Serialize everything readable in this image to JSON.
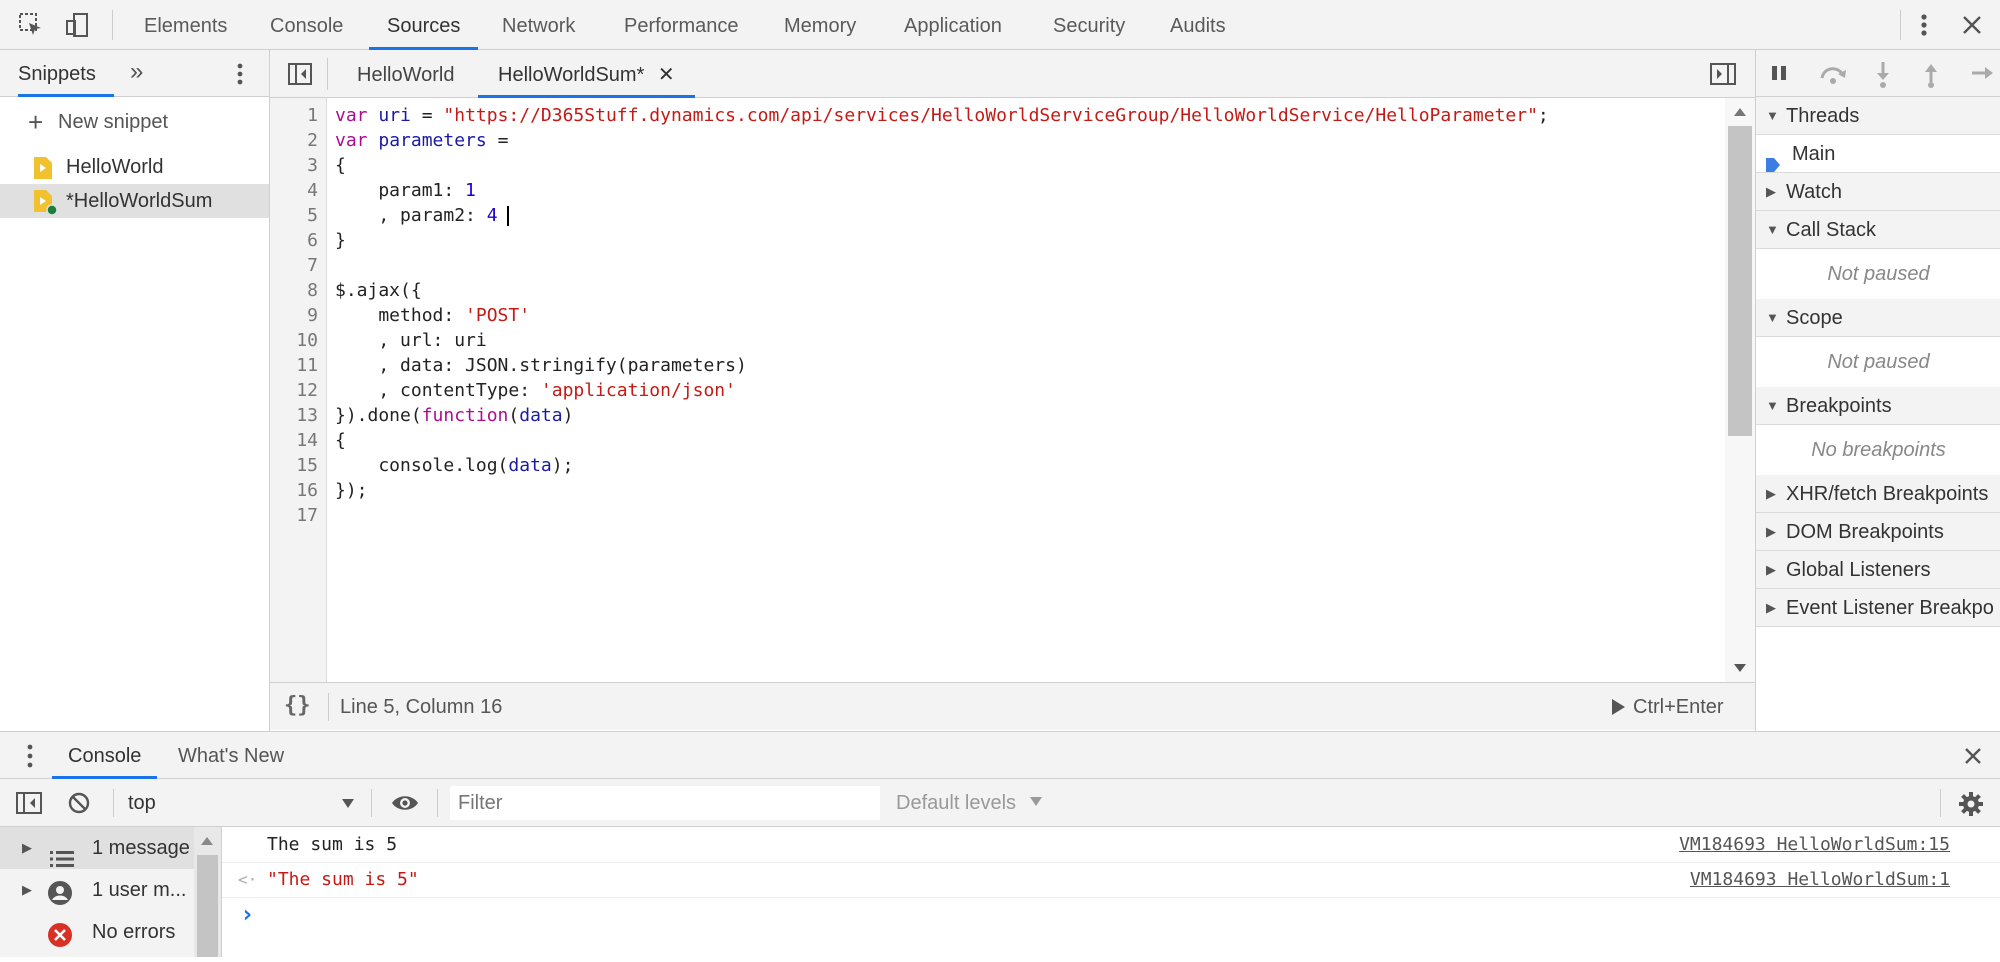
{
  "topbar": {
    "tabs": [
      "Elements",
      "Console",
      "Sources",
      "Network",
      "Performance",
      "Memory",
      "Application",
      "Security",
      "Audits"
    ],
    "active_tab": "Sources",
    "icons": [
      "inspect-element-icon",
      "device-toolbar-icon",
      "more-vert-icon",
      "close-icon"
    ],
    "accent_color": "#1a73e8"
  },
  "navigator": {
    "tab_label": "Snippets",
    "more_tabs_glyph": "»",
    "new_snippet_label": "New snippet",
    "items": [
      {
        "label": "HelloWorld",
        "selected": false
      },
      {
        "label": "*HelloWorldSum",
        "selected": true
      }
    ]
  },
  "editor": {
    "tabs": [
      {
        "label": "HelloWorld",
        "active": false
      },
      {
        "label": "HelloWorldSum*",
        "active": true,
        "close_glyph": "✕"
      }
    ],
    "line_numbers": [
      "1",
      "2",
      "3",
      "4",
      "5",
      "6",
      "7",
      "8",
      "9",
      "10",
      "11",
      "12",
      "13",
      "14",
      "15",
      "16",
      "17"
    ],
    "lines": [
      [
        [
          "kw",
          "var"
        ],
        [
          "plain",
          " "
        ],
        [
          "var",
          "uri"
        ],
        [
          "plain",
          " = "
        ],
        [
          "str",
          "\"https://D365Stuff.dynamics.com/api/services/HelloWorldServiceGroup/HelloWorldService/HelloParameter\""
        ],
        [
          "plain",
          ";"
        ]
      ],
      [
        [
          "kw",
          "var"
        ],
        [
          "plain",
          " "
        ],
        [
          "var",
          "parameters"
        ],
        [
          "plain",
          " ="
        ]
      ],
      [
        [
          "plain",
          "{"
        ]
      ],
      [
        [
          "plain",
          "    param1: "
        ],
        [
          "num",
          "1"
        ]
      ],
      [
        [
          "plain",
          "    , param2: "
        ],
        [
          "num",
          "4"
        ]
      ],
      [
        [
          "plain",
          "}"
        ]
      ],
      [
        [
          "plain",
          ""
        ]
      ],
      [
        [
          "plain",
          "$.ajax({"
        ]
      ],
      [
        [
          "plain",
          "    method: "
        ],
        [
          "str",
          "'POST'"
        ]
      ],
      [
        [
          "plain",
          "    , url: uri"
        ]
      ],
      [
        [
          "plain",
          "    , data: JSON.stringify(parameters)"
        ]
      ],
      [
        [
          "plain",
          "    , contentType: "
        ],
        [
          "str",
          "'application/json'"
        ]
      ],
      [
        [
          "plain",
          "}).done("
        ],
        [
          "kw",
          "function"
        ],
        [
          "plain",
          "("
        ],
        [
          "var",
          "data"
        ],
        [
          "plain",
          ")"
        ]
      ],
      [
        [
          "plain",
          "{"
        ]
      ],
      [
        [
          "plain",
          "    console.log("
        ],
        [
          "var",
          "data"
        ],
        [
          "plain",
          ");"
        ]
      ],
      [
        [
          "plain",
          "});"
        ]
      ],
      [
        [
          "plain",
          ""
        ]
      ]
    ],
    "status": {
      "format_glyph": "{}",
      "position": "Line 5, Column 16",
      "run_label": "Ctrl+Enter"
    }
  },
  "debugger": {
    "sections": [
      {
        "label": "Threads",
        "expanded": true
      },
      {
        "label": "Watch",
        "expanded": false
      },
      {
        "label": "Call Stack",
        "expanded": true
      },
      {
        "label": "Scope",
        "expanded": true
      },
      {
        "label": "Breakpoints",
        "expanded": true
      },
      {
        "label": "XHR/fetch Breakpoints",
        "expanded": false
      },
      {
        "label": "DOM Breakpoints",
        "expanded": false
      },
      {
        "label": "Global Listeners",
        "expanded": false
      },
      {
        "label": "Event Listener Breakpo",
        "expanded": false
      }
    ],
    "thread_main": "Main",
    "call_stack_empty": "Not paused",
    "scope_empty": "Not paused",
    "breakpoints_empty": "No breakpoints"
  },
  "drawer": {
    "tabs": [
      {
        "label": "Console",
        "active": true
      },
      {
        "label": "What's New",
        "active": false
      }
    ]
  },
  "console": {
    "context": "top",
    "filter_placeholder": "Filter",
    "levels_label": "Default levels",
    "sidebar": [
      {
        "label": "1 message",
        "icon": "list-icon"
      },
      {
        "label": "1 user m...",
        "icon": "user-icon"
      },
      {
        "label": "No errors",
        "icon": "error-icon",
        "color": "#d93025"
      }
    ],
    "messages": [
      {
        "text": "The sum is 5",
        "source": "VM184693 HelloWorldSum:15",
        "type": "log"
      },
      {
        "text": "\"The sum is 5\"",
        "source": "VM184693 HelloWorldSum:1",
        "type": "result"
      }
    ],
    "prompt_glyph": "›"
  }
}
